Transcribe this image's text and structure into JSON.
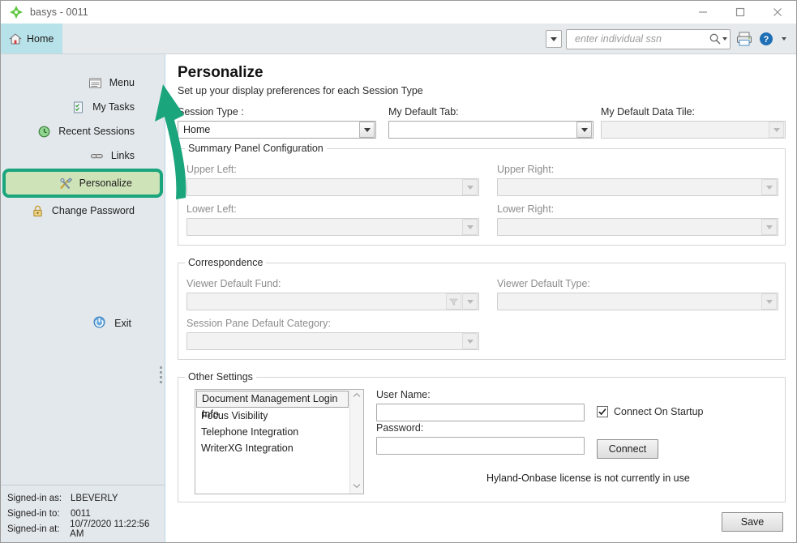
{
  "window": {
    "title": "basys - 0011",
    "logo_icon": "green-diamond-logo",
    "minimize": "—",
    "maximize": "□",
    "close": "✕"
  },
  "tabs": [
    {
      "label": "Home",
      "icon": "home-icon",
      "active": true
    }
  ],
  "toolbar": {
    "search_dropdown_icon": "chevron-down-icon",
    "search": {
      "placeholder": "enter individual ssn",
      "value": "",
      "search_icon": "magnifier-icon",
      "dropdown_icon": "chevron-down-icon"
    },
    "print_icon": "printer-icon",
    "help_icon": "help-circle-icon",
    "help_dropdown_icon": "chevron-down-icon"
  },
  "sidebar": {
    "items": [
      {
        "label": "Menu",
        "icon": "menu-list-icon",
        "selected": false
      },
      {
        "label": "My Tasks",
        "icon": "tasks-checklist-icon",
        "selected": false
      },
      {
        "label": "Recent Sessions",
        "icon": "clock-history-icon",
        "selected": false
      },
      {
        "label": "Links",
        "icon": "link-chain-icon",
        "selected": false
      },
      {
        "label": "Personalize",
        "icon": "tools-wrench-screwdriver-icon",
        "selected": true
      },
      {
        "label": "Change Password",
        "icon": "padlock-icon",
        "selected": false
      }
    ],
    "exit": {
      "label": "Exit",
      "icon": "power-icon"
    },
    "signed_in": [
      {
        "key": "Signed-in as:",
        "value": "LBEVERLY"
      },
      {
        "key": "Signed-in to:",
        "value": "0011"
      },
      {
        "key": "Signed-in at:",
        "value": "10/7/2020 11:22:56 AM"
      }
    ]
  },
  "main": {
    "title": "Personalize",
    "subtitle": "Set up your display preferences for each Session Type",
    "top_fields": [
      {
        "label": "Session Type :",
        "value": "Home",
        "disabled": false
      },
      {
        "label": "My Default Tab:",
        "value": "",
        "disabled": false
      },
      {
        "label": "My Default Data Tile:",
        "value": "",
        "disabled": true
      }
    ],
    "summary_panel": {
      "title": "Summary Panel Configuration",
      "fields": [
        {
          "label": "Upper Left:",
          "value": "",
          "disabled": true
        },
        {
          "label": "Upper Right:",
          "value": "",
          "disabled": true
        },
        {
          "label": "Lower Left:",
          "value": "",
          "disabled": true
        },
        {
          "label": "Lower Right:",
          "value": "",
          "disabled": true
        }
      ]
    },
    "correspondence": {
      "title": "Correspondence",
      "fields": [
        {
          "label": "Viewer Default Fund:",
          "value": "",
          "disabled": true,
          "filter_icon": "funnel-filter-icon"
        },
        {
          "label": "Viewer Default Type:",
          "value": "",
          "disabled": true
        },
        {
          "label": "Session Pane Default Category:",
          "value": "",
          "disabled": true
        }
      ]
    },
    "other_settings": {
      "title": "Other Settings",
      "list": [
        {
          "label": "Document Management Login Info",
          "selected": true
        },
        {
          "label": "Focus Visibility",
          "selected": false
        },
        {
          "label": "Telephone Integration",
          "selected": false
        },
        {
          "label": "WriterXG Integration",
          "selected": false
        }
      ],
      "scroll_up_icon": "chevron-up-icon",
      "scroll_down_icon": "chevron-down-icon",
      "user_name_label": "User Name:",
      "user_name_value": "",
      "password_label": "Password:",
      "password_value": "",
      "connect_on_startup_label": "Connect On Startup",
      "connect_on_startup_checked": true,
      "connect_button": "Connect",
      "license_status": "Hyland-Onbase license is not currently in use"
    },
    "save_button": "Save"
  },
  "annotation": {
    "type": "arrow",
    "color": "#1ba57d",
    "points_to": "sidebar-item-personalize"
  },
  "colors": {
    "accent_green": "#1ba57d",
    "highlight_fill": "#cfe3b8",
    "tab_active": "#b8e2e9",
    "sidebar_bg": "#e3e8ec",
    "tabstrip_bg": "#e6eaed"
  }
}
